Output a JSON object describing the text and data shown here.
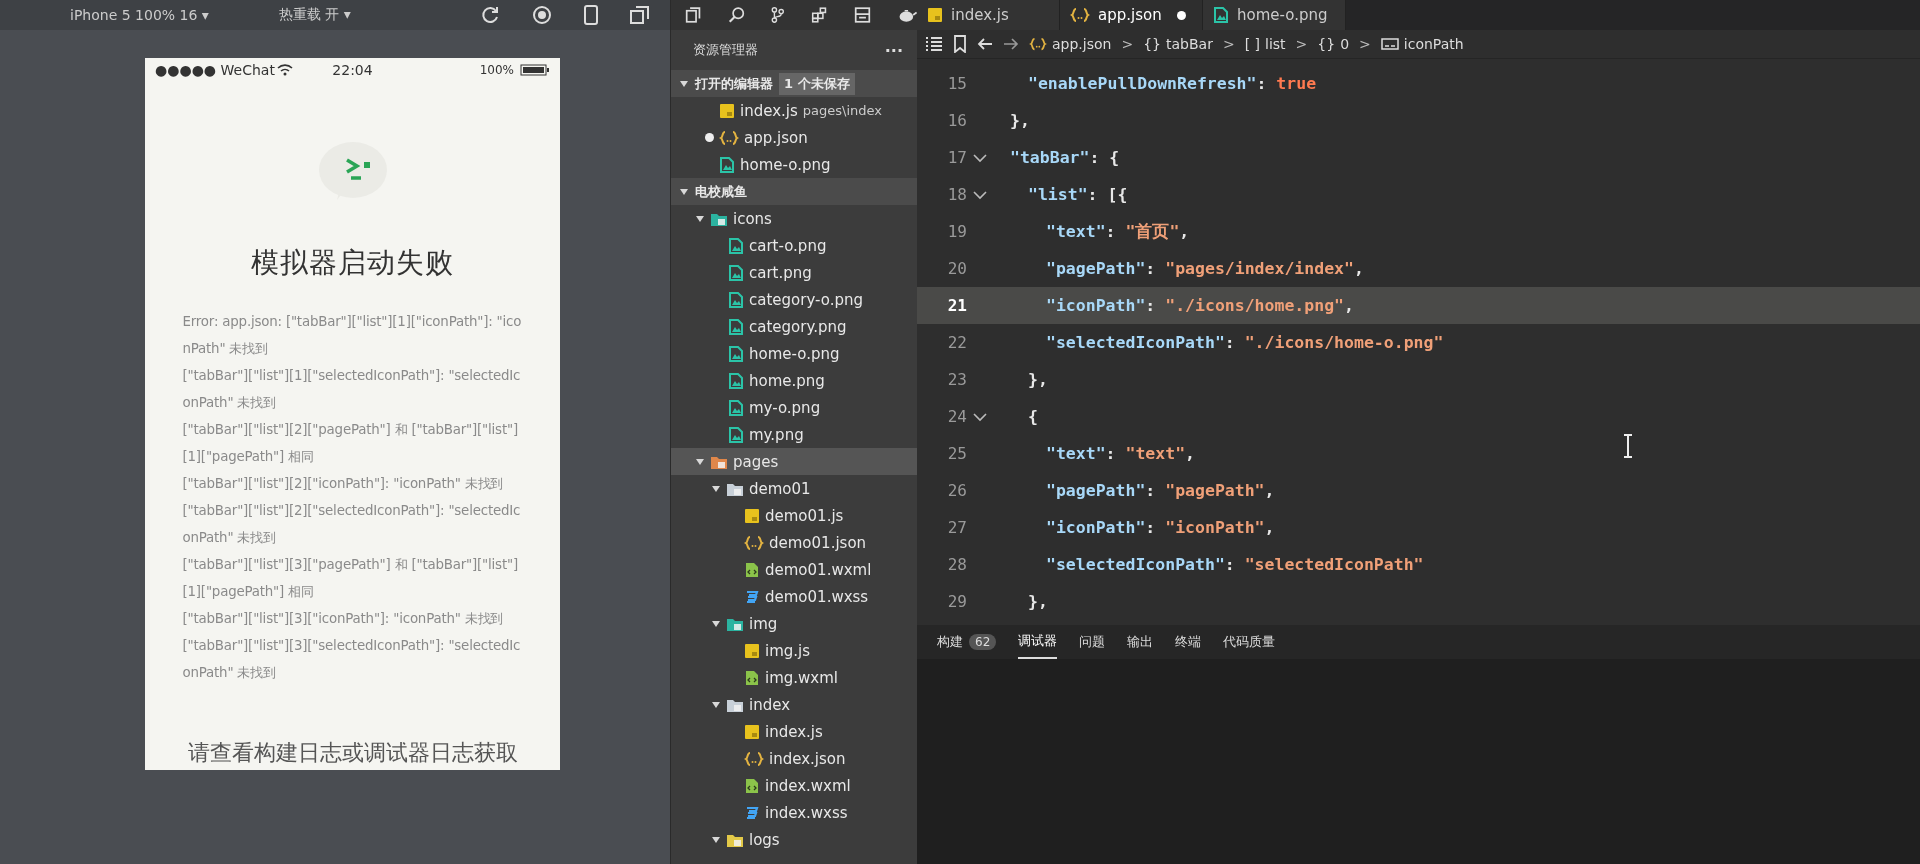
{
  "simulator": {
    "toolbar": {
      "device": "iPhone 5 100% 16 ▾",
      "hot_reload": "热重载 开 ▾"
    },
    "phone": {
      "status_bar": {
        "carrier": "●●●●● WeChat",
        "time": "22:04",
        "battery": "100%"
      },
      "title": "模拟器启动失败",
      "errors": [
        "Error: app.json: [\"tabBar\"][\"list\"][1][\"iconPath\"]: \"iconPath\" 未找到",
        "[\"tabBar\"][\"list\"][1][\"selectedIconPath\"]: \"selectedIconPath\" 未找到",
        "[\"tabBar\"][\"list\"][2][\"pagePath\"] 和 [\"tabBar\"][\"list\"][1][\"pagePath\"] 相同",
        "[\"tabBar\"][\"list\"][2][\"iconPath\"]: \"iconPath\" 未找到",
        "[\"tabBar\"][\"list\"][2][\"selectedIconPath\"]: \"selectedIconPath\" 未找到",
        "[\"tabBar\"][\"list\"][3][\"pagePath\"] 和 [\"tabBar\"][\"list\"][1][\"pagePath\"] 相同",
        "[\"tabBar\"][\"list\"][3][\"iconPath\"]: \"iconPath\" 未找到",
        "[\"tabBar\"][\"list\"][3][\"selectedIconPath\"]: \"selectedIconPath\" 未找到"
      ],
      "footer": "请查看构建日志或调试器日志获取"
    }
  },
  "explorer": {
    "title": "资源管理器",
    "more": "···",
    "open_editors": {
      "label": "打开的编辑器",
      "badge": "1 个未保存",
      "expanded": true,
      "items": [
        {
          "name": "index.js",
          "detail": "pages\\index",
          "kind": "js",
          "modified": false
        },
        {
          "name": "app.json",
          "kind": "json",
          "modified": true
        },
        {
          "name": "home-o.png",
          "kind": "image",
          "modified": false
        }
      ]
    },
    "project": {
      "label": "电校咸鱼",
      "expanded": true,
      "children": [
        {
          "name": "icons",
          "kind": "folder",
          "color": "#2bb3a0",
          "expanded": true,
          "selected": false,
          "children": [
            {
              "name": "cart-o.png",
              "kind": "image",
              "selected": false
            },
            {
              "name": "cart.png",
              "kind": "image",
              "selected": false
            },
            {
              "name": "category-o.png",
              "kind": "image",
              "selected": false
            },
            {
              "name": "category.png",
              "kind": "image",
              "selected": false
            },
            {
              "name": "home-o.png",
              "kind": "image",
              "selected": false
            },
            {
              "name": "home.png",
              "kind": "image",
              "selected": false
            },
            {
              "name": "my-o.png",
              "kind": "image",
              "selected": false
            },
            {
              "name": "my.png",
              "kind": "image",
              "selected": false
            }
          ]
        },
        {
          "name": "pages",
          "kind": "folder",
          "color": "#e0874a",
          "expanded": true,
          "selected": true,
          "children": [
            {
              "name": "demo01",
              "kind": "folder",
              "color": "#c8d0d8",
              "expanded": true,
              "selected": false,
              "children": [
                {
                  "name": "demo01.js",
                  "kind": "js",
                  "selected": false
                },
                {
                  "name": "demo01.json",
                  "kind": "json",
                  "selected": false
                },
                {
                  "name": "demo01.wxml",
                  "kind": "wxml",
                  "selected": false
                },
                {
                  "name": "demo01.wxss",
                  "kind": "wxss",
                  "selected": false
                }
              ]
            },
            {
              "name": "img",
              "kind": "folder",
              "color": "#2bb3a0",
              "expanded": true,
              "selected": false,
              "children": [
                {
                  "name": "img.js",
                  "kind": "js",
                  "selected": false
                },
                {
                  "name": "img.wxml",
                  "kind": "wxml",
                  "selected": false
                }
              ]
            },
            {
              "name": "index",
              "kind": "folder",
              "color": "#c8d0d8",
              "expanded": true,
              "selected": false,
              "children": [
                {
                  "name": "index.js",
                  "kind": "js",
                  "selected": false
                },
                {
                  "name": "index.json",
                  "kind": "json",
                  "selected": false
                },
                {
                  "name": "index.wxml",
                  "kind": "wxml",
                  "selected": false
                },
                {
                  "name": "index.wxss",
                  "kind": "wxss",
                  "selected": false
                }
              ]
            },
            {
              "name": "logs",
              "kind": "folder",
              "color": "#e3c948",
              "expanded": true,
              "selected": false
            }
          ]
        }
      ]
    }
  },
  "editor": {
    "tabs": [
      {
        "label": "index.js",
        "kind": "js",
        "selected": false,
        "modified": false
      },
      {
        "label": "app.json",
        "kind": "json",
        "selected": true,
        "modified": true
      },
      {
        "label": "home-o.png",
        "kind": "image",
        "selected": false,
        "modified": false
      }
    ],
    "breadcrumb": {
      "separator": ">",
      "items": [
        {
          "kind": "file",
          "label": "app.json"
        },
        {
          "kind": "object",
          "icon": "{}",
          "label": "tabBar"
        },
        {
          "kind": "array",
          "icon": "[ ]",
          "label": "list"
        },
        {
          "kind": "object",
          "icon": "{}",
          "label": "0"
        },
        {
          "kind": "string",
          "label": "iconPath"
        }
      ]
    },
    "lines": [
      {
        "number": "15",
        "foldable": false,
        "current": false,
        "tokens": [
          {
            "kind": "key",
            "text": "\"enablePullDownRefresh\""
          },
          {
            "kind": "punct",
            "text": ": "
          },
          {
            "kind": "bool",
            "text": "true"
          }
        ]
      },
      {
        "number": "16",
        "foldable": false,
        "current": false,
        "tokens": [
          {
            "kind": "punct",
            "text": "},"
          }
        ]
      },
      {
        "number": "17",
        "foldable": true,
        "current": false,
        "tokens": [
          {
            "kind": "key",
            "text": "\"tabBar\""
          },
          {
            "kind": "punct",
            "text": ": {"
          }
        ]
      },
      {
        "number": "18",
        "foldable": true,
        "current": false,
        "tokens": [
          {
            "kind": "key",
            "text": "\"list\""
          },
          {
            "kind": "punct",
            "text": ": [{"
          }
        ]
      },
      {
        "number": "19",
        "foldable": false,
        "current": false,
        "tokens": [
          {
            "kind": "key",
            "text": "\"text\""
          },
          {
            "kind": "punct",
            "text": ": "
          },
          {
            "kind": "string",
            "text": "\"首页\""
          },
          {
            "kind": "punct",
            "text": ","
          }
        ]
      },
      {
        "number": "20",
        "foldable": false,
        "current": false,
        "tokens": [
          {
            "kind": "key",
            "text": "\"pagePath\""
          },
          {
            "kind": "punct",
            "text": ": "
          },
          {
            "kind": "string",
            "text": "\"pages/index/index\""
          },
          {
            "kind": "punct",
            "text": ","
          }
        ]
      },
      {
        "number": "21",
        "foldable": false,
        "current": true,
        "tokens": [
          {
            "kind": "key",
            "text": "\"iconPath\""
          },
          {
            "kind": "punct",
            "text": ": "
          },
          {
            "kind": "string",
            "text": "\"./icons/home.png\""
          },
          {
            "kind": "punct",
            "text": ","
          }
        ]
      },
      {
        "number": "22",
        "foldable": false,
        "current": false,
        "tokens": [
          {
            "kind": "key",
            "text": "\"selectedIconPath\""
          },
          {
            "kind": "punct",
            "text": ": "
          },
          {
            "kind": "string",
            "text": "\"./icons/home-o.png\""
          }
        ]
      },
      {
        "number": "23",
        "foldable": false,
        "current": false,
        "tokens": [
          {
            "kind": "punct",
            "text": "},"
          }
        ]
      },
      {
        "number": "24",
        "foldable": true,
        "current": false,
        "tokens": [
          {
            "kind": "punct",
            "text": "{"
          }
        ]
      },
      {
        "number": "25",
        "foldable": false,
        "current": false,
        "tokens": [
          {
            "kind": "key",
            "text": "\"text\""
          },
          {
            "kind": "punct",
            "text": ": "
          },
          {
            "kind": "string",
            "text": "\"text\""
          },
          {
            "kind": "punct",
            "text": ","
          }
        ]
      },
      {
        "number": "26",
        "foldable": false,
        "current": false,
        "tokens": [
          {
            "kind": "key",
            "text": "\"pagePath\""
          },
          {
            "kind": "punct",
            "text": ": "
          },
          {
            "kind": "string",
            "text": "\"pagePath\""
          },
          {
            "kind": "punct",
            "text": ","
          }
        ]
      },
      {
        "number": "27",
        "foldable": false,
        "current": false,
        "tokens": [
          {
            "kind": "key",
            "text": "\"iconPath\""
          },
          {
            "kind": "punct",
            "text": ": "
          },
          {
            "kind": "string",
            "text": "\"iconPath\""
          },
          {
            "kind": "punct",
            "text": ","
          }
        ]
      },
      {
        "number": "28",
        "foldable": false,
        "current": false,
        "tokens": [
          {
            "kind": "key",
            "text": "\"selectedIconPath\""
          },
          {
            "kind": "punct",
            "text": ": "
          },
          {
            "kind": "string",
            "text": "\"selectedIconPath\""
          }
        ]
      },
      {
        "number": "29",
        "foldable": false,
        "current": false,
        "tokens": [
          {
            "kind": "punct",
            "text": "},"
          }
        ]
      }
    ]
  },
  "panel": {
    "tabs": [
      {
        "label": "构建",
        "badge": "62",
        "selected": false
      },
      {
        "label": "调试器",
        "selected": true
      },
      {
        "label": "问题",
        "selected": false
      },
      {
        "label": "输出",
        "selected": false
      },
      {
        "label": "终端",
        "selected": false
      },
      {
        "label": "代码质量",
        "selected": false
      }
    ]
  }
}
